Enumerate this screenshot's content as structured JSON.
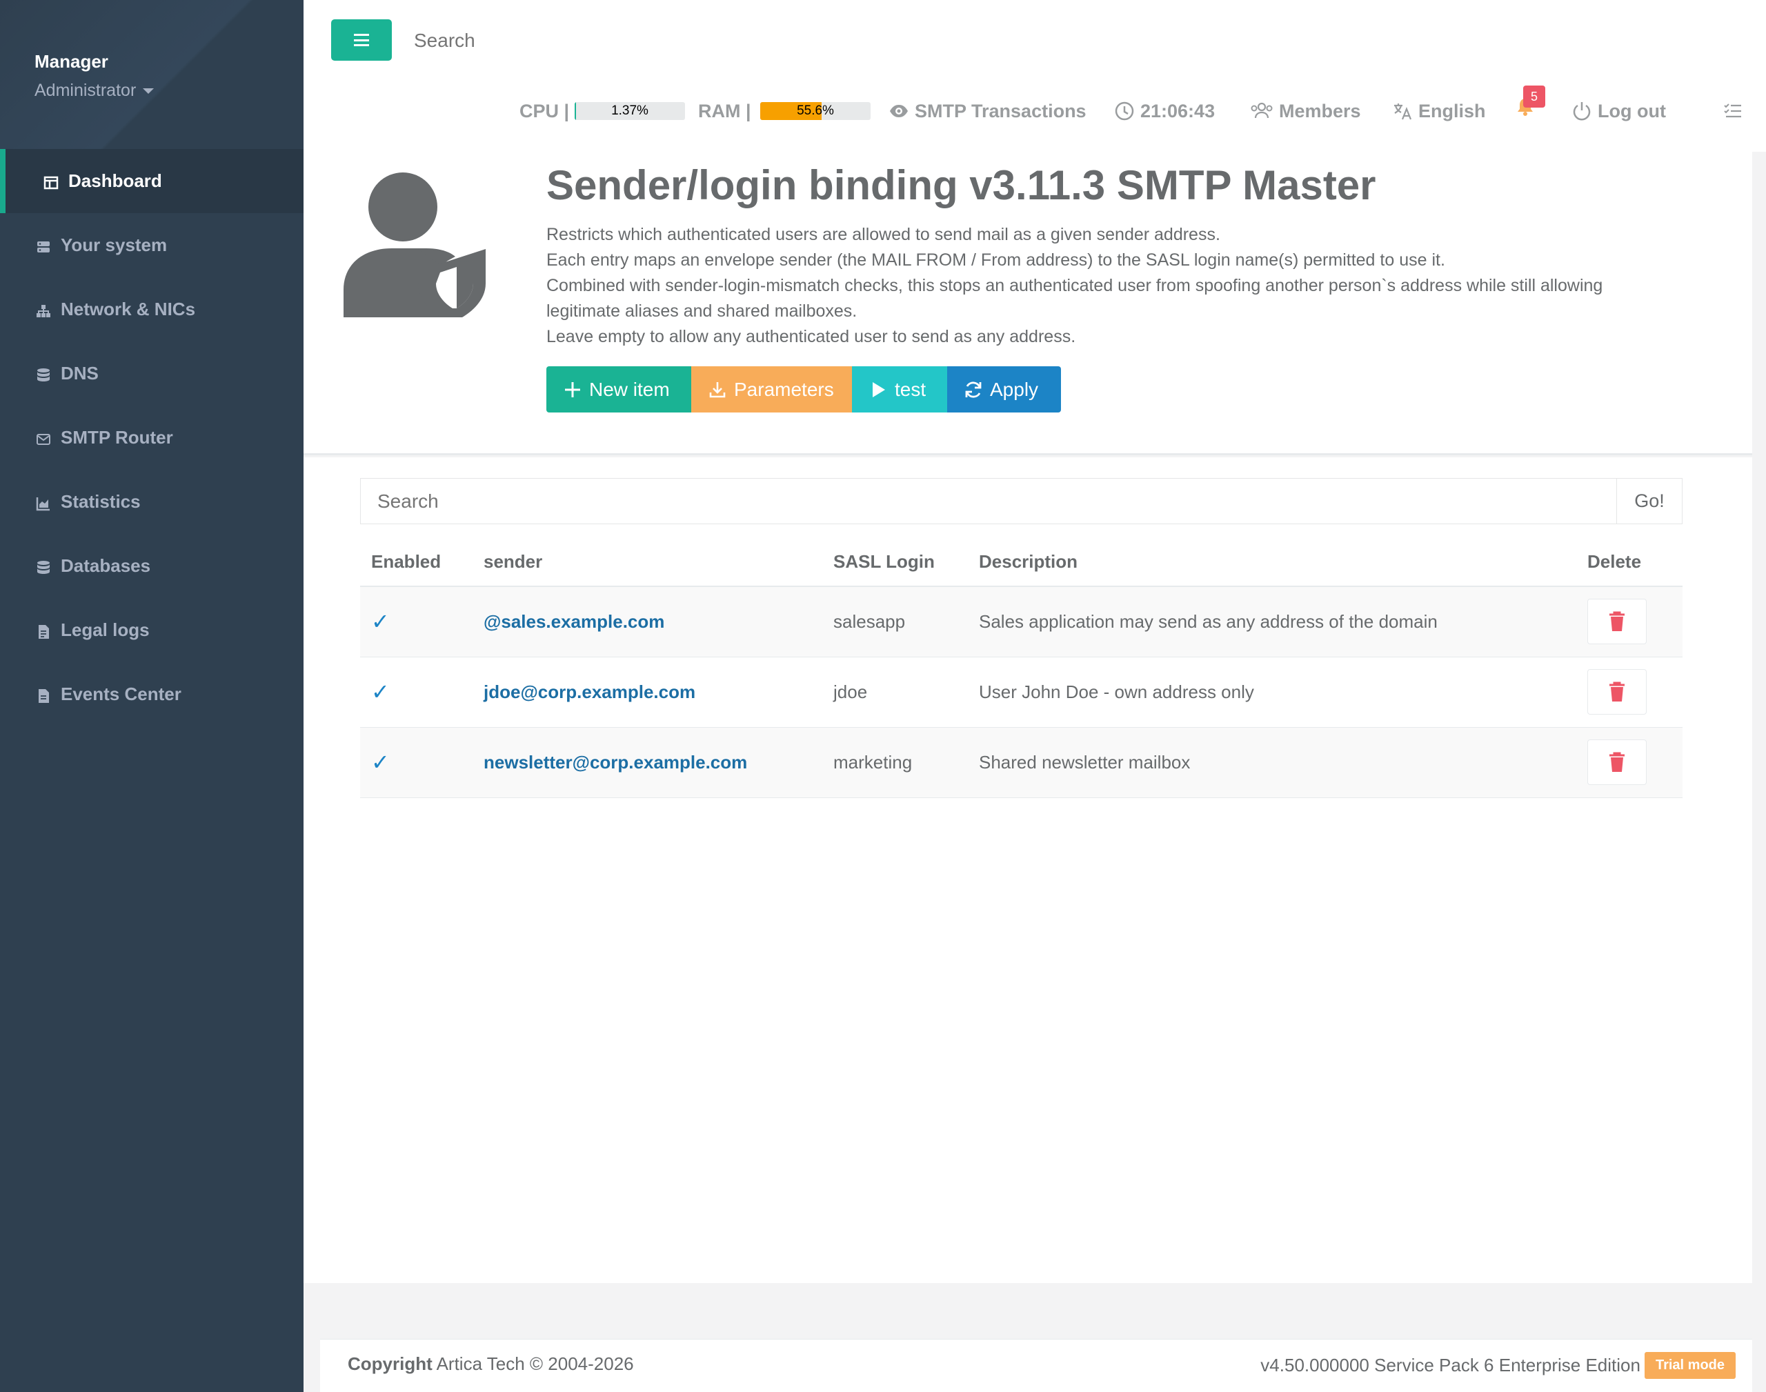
{
  "sidebar": {
    "profile": {
      "name": "Manager",
      "role": "Administrator"
    },
    "items": [
      {
        "label": "Dashboard",
        "icon": "dashboard-icon"
      },
      {
        "label": "Your system",
        "icon": "server-icon"
      },
      {
        "label": "Network & NICs",
        "icon": "network-icon"
      },
      {
        "label": "DNS",
        "icon": "database-icon"
      },
      {
        "label": "SMTP Router",
        "icon": "envelope-icon"
      },
      {
        "label": "Statistics",
        "icon": "chart-icon"
      },
      {
        "label": "Databases",
        "icon": "database-icon"
      },
      {
        "label": "Legal logs",
        "icon": "file-icon"
      },
      {
        "label": "Events Center",
        "icon": "file-icon"
      }
    ],
    "active": "Dashboard"
  },
  "topbar": {
    "search_placeholder": "Search",
    "cpu": {
      "label": "CPU |",
      "value_text": "1.37%",
      "percent": 1.37
    },
    "ram": {
      "label": "RAM |",
      "value_text": "55.6%",
      "percent": 55.6
    },
    "smtp_transactions": "SMTP Transactions",
    "clock": "21:06:43",
    "members": "Members",
    "language": "English",
    "notifications_count": "5",
    "logout": "Log out"
  },
  "header": {
    "title": "Sender/login binding v3.11.3 SMTP Master",
    "description": [
      "Restricts which authenticated users are allowed to send mail as a given sender address.",
      "Each entry maps an envelope sender (the MAIL FROM / From address) to the SASL login name(s) permitted to use it.",
      "Combined with sender-login-mismatch checks, this stops an authenticated user from spoofing another person`s address while still allowing legitimate aliases and shared mailboxes.",
      "Leave empty to allow any authenticated user to send as any address."
    ],
    "buttons": {
      "new_item": "New item",
      "parameters": "Parameters",
      "test": "test",
      "apply": "Apply"
    }
  },
  "table": {
    "search_placeholder": "Search",
    "go_label": "Go!",
    "columns": [
      "Enabled",
      "sender",
      "SASL Login",
      "Description",
      "Delete"
    ],
    "rows": [
      {
        "enabled": "✓",
        "sender": "@sales.example.com",
        "login": "salesapp",
        "description": "Sales application may send as any address of the domain"
      },
      {
        "enabled": "✓",
        "sender": "jdoe@corp.example.com",
        "login": "jdoe",
        "description": "User John Doe - own address only"
      },
      {
        "enabled": "✓",
        "sender": "newsletter@corp.example.com",
        "login": "marketing",
        "description": "Shared newsletter mailbox"
      }
    ]
  },
  "footer": {
    "copyright_label": "Copyright",
    "copyright_text": "Artica Tech © 2004-2026",
    "version": "v4.50.000000 Service Pack 6 Enterprise Edition",
    "trial": "Trial mode"
  },
  "colors": {
    "sidebar_bg": "#2f4050",
    "accent_green": "#1ab394",
    "warning_orange": "#f8ac59",
    "info_cyan": "#23c6c8",
    "primary_blue": "#1c84c6",
    "danger_red": "#ed5565",
    "ram_bar": "#f7a000",
    "cpu_bar": "#1ab394"
  }
}
